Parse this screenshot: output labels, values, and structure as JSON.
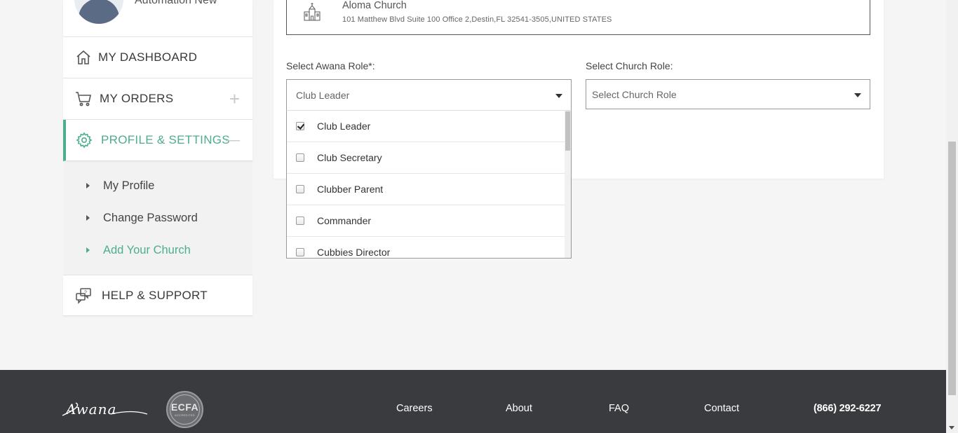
{
  "sidebar": {
    "user_name": "Automation New",
    "items": [
      {
        "label": "MY DASHBOARD",
        "icon": "home-icon"
      },
      {
        "label": "MY ORDERS",
        "icon": "cart-icon",
        "toggle": "+"
      },
      {
        "label": "PROFILE & SETTINGS",
        "icon": "gear-icon",
        "toggle": "—"
      },
      {
        "label": "HELP & SUPPORT",
        "icon": "help-chat-icon"
      }
    ],
    "sub_items": [
      {
        "label": "My Profile"
      },
      {
        "label": "Change Password"
      },
      {
        "label": "Add Your Church"
      }
    ]
  },
  "church": {
    "name": "Aloma Church",
    "address": "101 Matthew Blvd Suite 100 Office 2,Destin,FL 32541-3505,UNITED STATES"
  },
  "awana_role": {
    "label": "Select Awana Role*:",
    "value": "Club Leader",
    "options": [
      {
        "label": "Club Leader",
        "checked": true
      },
      {
        "label": "Club Secretary",
        "checked": false
      },
      {
        "label": "Clubber Parent",
        "checked": false
      },
      {
        "label": "Commander",
        "checked": false
      },
      {
        "label": "Cubbies Director",
        "checked": false
      }
    ]
  },
  "church_role": {
    "label": "Select Church Role:",
    "value": "Select Church Role"
  },
  "footer": {
    "logo_text": "Awana",
    "ecfa_text": "ECFA",
    "ecfa_sub": "ACCREDITED",
    "links": [
      "Careers",
      "About",
      "FAQ",
      "Contact"
    ],
    "phone": "(866) 292-6227"
  },
  "colors": {
    "accent": "#4cae8c",
    "footer_bg": "#3a3b3e"
  }
}
